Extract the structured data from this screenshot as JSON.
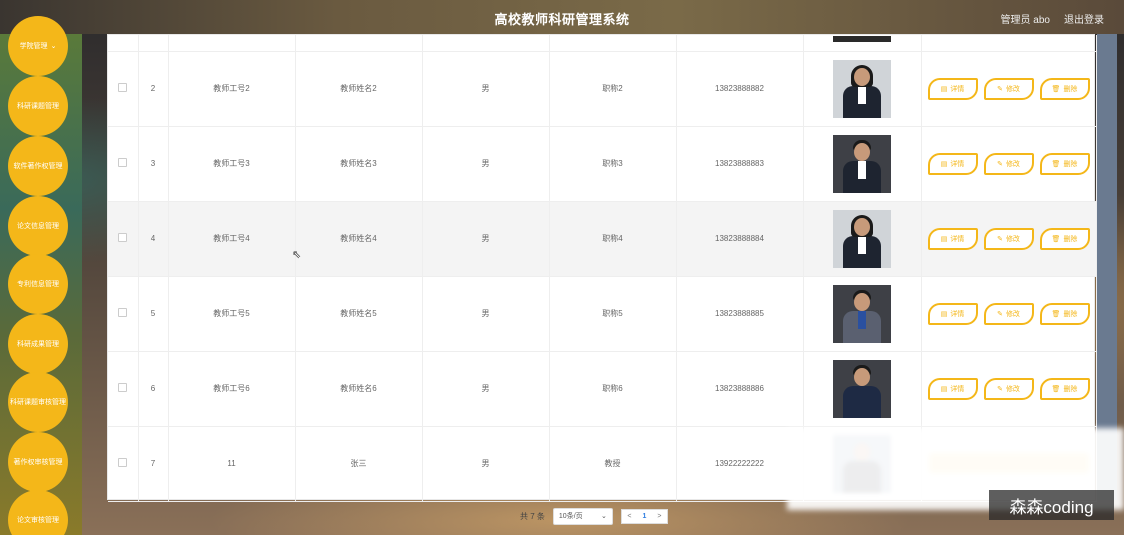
{
  "header": {
    "title": "高校教师科研管理系统",
    "user": "管理员 abo",
    "logout": "退出登录"
  },
  "sidebar": {
    "items": [
      {
        "label": "学院管理",
        "has_chevron": true
      },
      {
        "label": "科研课题管理"
      },
      {
        "label": "软件著作权管理"
      },
      {
        "label": "论文信息管理"
      },
      {
        "label": "专利信息管理"
      },
      {
        "label": "科研成果管理"
      },
      {
        "label": "科研课题审核管理"
      },
      {
        "label": "著作权审核管理"
      },
      {
        "label": "论文审核管理"
      }
    ]
  },
  "table": {
    "rows": [
      {
        "index": "2",
        "teacher_id": "教师工号2",
        "name": "教师姓名2",
        "gender": "男",
        "title": "职称2",
        "phone": "13823888882",
        "photo": "female-portrait"
      },
      {
        "index": "3",
        "teacher_id": "教师工号3",
        "name": "教师姓名3",
        "gender": "男",
        "title": "职称3",
        "phone": "13823888883",
        "photo": "male-portrait"
      },
      {
        "index": "4",
        "teacher_id": "教师工号4",
        "name": "教师姓名4",
        "gender": "男",
        "title": "职称4",
        "phone": "13823888884",
        "photo": "female-portrait"
      },
      {
        "index": "5",
        "teacher_id": "教师工号5",
        "name": "教师姓名5",
        "gender": "男",
        "title": "职称5",
        "phone": "13823888885",
        "photo": "male-portrait"
      },
      {
        "index": "6",
        "teacher_id": "教师工号6",
        "name": "教师姓名6",
        "gender": "男",
        "title": "职称6",
        "phone": "13823888886",
        "photo": "male-portrait"
      },
      {
        "index": "7",
        "teacher_id": "11",
        "name": "张三",
        "gender": "男",
        "title": "教授",
        "phone": "13922222222",
        "photo": "blurred-portrait"
      }
    ],
    "actions": {
      "detail": "详情",
      "edit": "修改",
      "delete": "删除"
    }
  },
  "pagination": {
    "total": "共 7 条",
    "page_size": "10条/页",
    "prev": "<",
    "current_page": "1",
    "next": ">"
  },
  "watermark": "森森coding",
  "colors": {
    "accent": "#f4b719",
    "page_active": "#2f7de1"
  }
}
